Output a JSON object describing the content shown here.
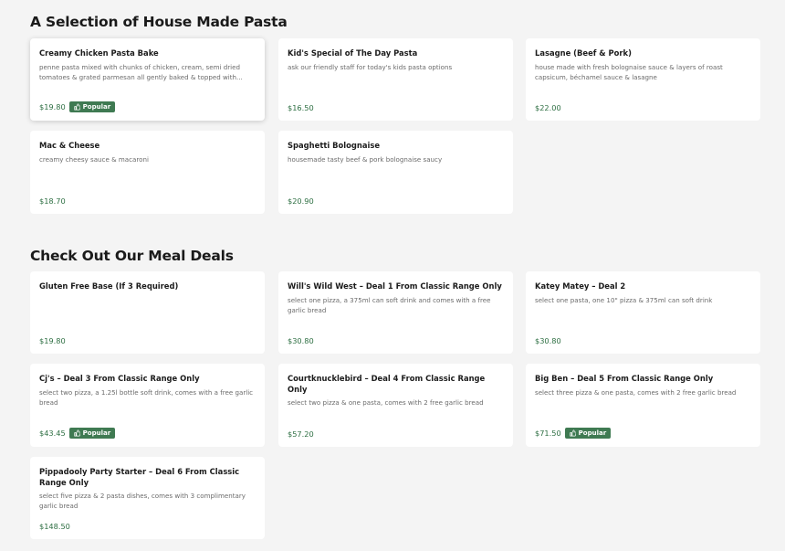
{
  "sections": [
    {
      "title": "A Selection of House Made Pasta",
      "items": [
        {
          "name": "Creamy Chicken Pasta Bake",
          "desc": "penne pasta mixed with chunks of chicken, cream, semi dried tomatoes & grated parmesan all gently baked & topped with...",
          "price": "$19.80",
          "badge": "Popular"
        },
        {
          "name": "Kid's Special of The Day Pasta",
          "desc": "ask our friendly staff for today's kids pasta options",
          "price": "$16.50",
          "badge": ""
        },
        {
          "name": "Lasagne (Beef & Pork)",
          "desc": "house made with fresh bolognaise sauce & layers of roast capsicum, béchamel sauce & lasagne",
          "price": "$22.00",
          "badge": ""
        },
        {
          "name": "Mac & Cheese",
          "desc": "creamy cheesy sauce & macaroni",
          "price": "$18.70",
          "badge": ""
        },
        {
          "name": "Spaghetti Bolognaise",
          "desc": "housemade tasty beef & pork bolognaise saucy",
          "price": "$20.90",
          "badge": ""
        }
      ]
    },
    {
      "title": "Check Out Our Meal Deals",
      "items": [
        {
          "name": "Gluten Free Base (If 3 Required)",
          "desc": "",
          "price": "$19.80",
          "badge": ""
        },
        {
          "name": "Will's Wild West – Deal 1 From Classic Range Only",
          "desc": "select one pizza, a 375ml can soft drink and comes with a free garlic bread",
          "price": "$30.80",
          "badge": ""
        },
        {
          "name": "Katey Matey – Deal 2",
          "desc": "select one pasta, one 10\" pizza & 375ml can soft drink",
          "price": "$30.80",
          "badge": ""
        },
        {
          "name": "Cj's – Deal 3 From Classic Range Only",
          "desc": "select two pizza, a 1.25l bottle soft drink, comes with a free garlic bread",
          "price": "$43.45",
          "badge": "Popular"
        },
        {
          "name": "Courtknucklebird – Deal 4 From Classic Range Only",
          "desc": "select two pizza & one pasta, comes with 2 free garlic bread",
          "price": "$57.20",
          "badge": ""
        },
        {
          "name": "Big Ben – Deal 5 From Classic Range Only",
          "desc": "select three pizza & one pasta, comes with 2 free garlic bread",
          "price": "$71.50",
          "badge": "Popular"
        },
        {
          "name": "Pippadooly Party Starter – Deal 6 From Classic Range Only",
          "desc": "select five pizza & 2 pasta dishes, comes with 3 complimentary garlic bread",
          "price": "$148.50",
          "badge": ""
        }
      ]
    }
  ],
  "icons": {
    "badge_icon": "thumbs-up-icon"
  },
  "colors": {
    "price": "#2e6f43",
    "badge_bg": "#3f7a52",
    "page_bg": "#f4f4f4"
  }
}
